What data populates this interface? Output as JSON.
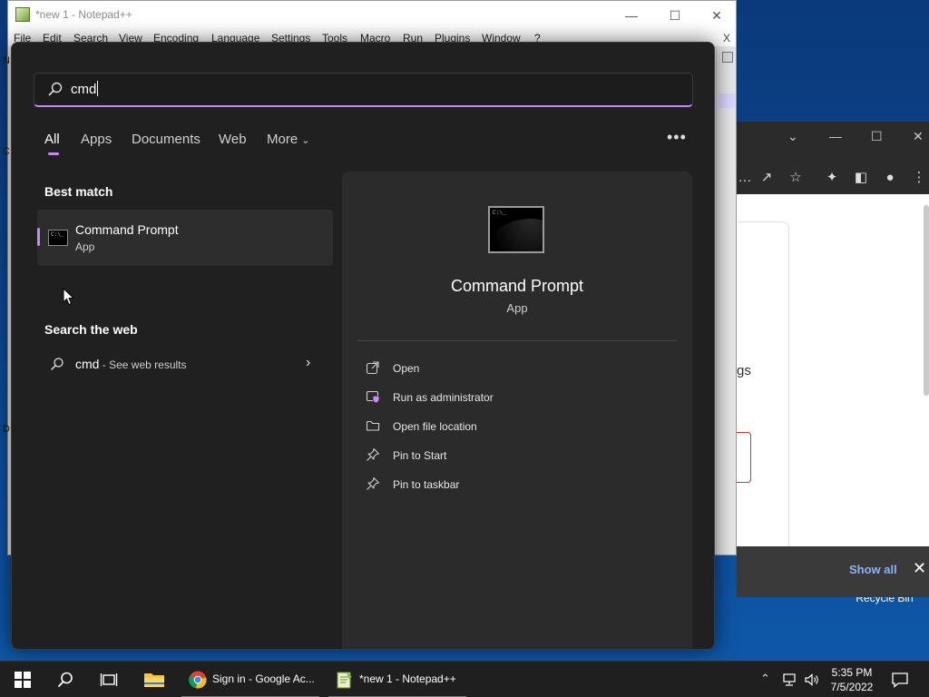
{
  "desktop": {
    "recycle_bin_label": "Recycle Bin"
  },
  "notepad": {
    "title": "*new 1 - Notepad++",
    "menu": [
      "File",
      "Edit",
      "Search",
      "View",
      "Encoding",
      "Language",
      "Settings",
      "Tools",
      "Macro",
      "Run",
      "Plugins",
      "Window",
      "?"
    ],
    "close_doc_label": "X",
    "left_fragments": [
      "N",
      "C",
      "D"
    ]
  },
  "chrome": {
    "page_text_fragment": "gs",
    "download_bar": {
      "show_all_label": "Show all"
    }
  },
  "search": {
    "query": "cmd",
    "tabs": [
      "All",
      "Apps",
      "Documents",
      "Web",
      "More"
    ],
    "active_tab": "All",
    "more_options_label": "•••",
    "best_match": {
      "section_title": "Best match",
      "name": "Command Prompt",
      "type": "App"
    },
    "web": {
      "section_title": "Search the web",
      "query": "cmd",
      "suffix": " - See web results"
    },
    "details": {
      "title": "Command Prompt",
      "type": "App",
      "actions": [
        {
          "label": "Open",
          "icon": "open-external-icon"
        },
        {
          "label": "Run as administrator",
          "icon": "shield-admin-icon"
        },
        {
          "label": "Open file location",
          "icon": "folder-icon"
        },
        {
          "label": "Pin to Start",
          "icon": "pin-icon"
        },
        {
          "label": "Pin to taskbar",
          "icon": "pin-icon"
        }
      ]
    }
  },
  "taskbar": {
    "apps": [
      {
        "label": "Sign in - Google Ac...",
        "icon": "chrome-icon"
      },
      {
        "label": "*new 1 - Notepad++",
        "icon": "notepad-plus-plus-icon"
      }
    ],
    "clock": {
      "time": "5:35 PM",
      "date": "7/5/2022"
    }
  },
  "colors": {
    "accent": "#c58af9",
    "panel_bg": "#202020",
    "detail_bg": "#2b2b2b",
    "taskbar_bg": "#1f1f1f"
  }
}
